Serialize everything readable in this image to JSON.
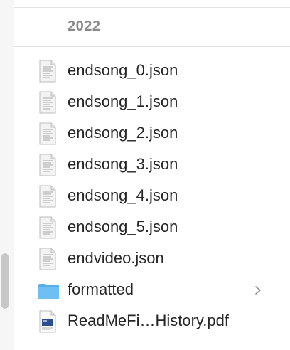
{
  "section": {
    "title": "2022"
  },
  "files": [
    {
      "name": "endsong_0.json",
      "icon": "json-file-icon"
    },
    {
      "name": "endsong_1.json",
      "icon": "json-file-icon"
    },
    {
      "name": "endsong_2.json",
      "icon": "json-file-icon"
    },
    {
      "name": "endsong_3.json",
      "icon": "json-file-icon"
    },
    {
      "name": "endsong_4.json",
      "icon": "json-file-icon"
    },
    {
      "name": "endsong_5.json",
      "icon": "json-file-icon"
    },
    {
      "name": "endvideo.json",
      "icon": "json-file-icon"
    },
    {
      "name": "formatted",
      "icon": "folder-icon"
    },
    {
      "name": "ReadMeFi…History.pdf",
      "icon": "pdf-file-icon"
    }
  ],
  "colors": {
    "folder": "#5fb6ee",
    "text": "#262626",
    "header": "#8a8a8a"
  }
}
